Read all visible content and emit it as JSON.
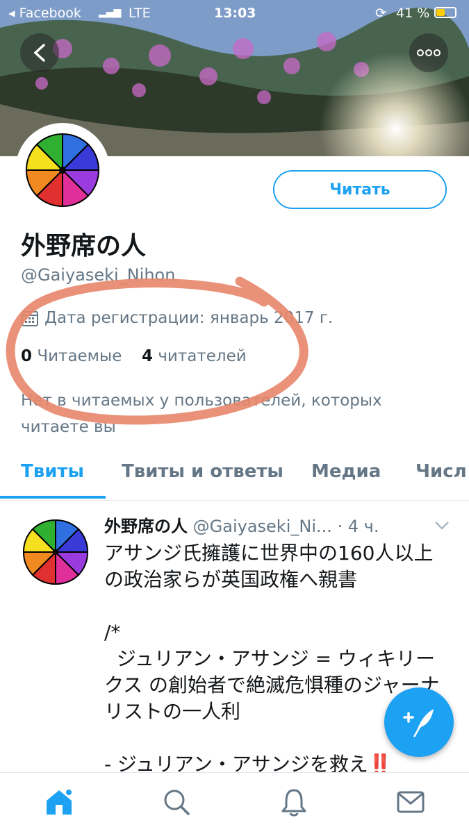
{
  "status_bar": {
    "back_app": "Facebook",
    "network": "LTE",
    "time": "13:03",
    "battery": "41 %"
  },
  "icons": {
    "back": "back-arrow-icon",
    "more": "more-dots-icon",
    "calendar": "calendar-icon",
    "compose": "compose-feather-icon",
    "home": "home-icon",
    "search": "search-icon",
    "notifications": "bell-icon",
    "messages": "mail-icon",
    "dropdown": "chevron-down-icon"
  },
  "colors": {
    "accent": "#1da1f2",
    "secondary_text": "#657786",
    "primary_text": "#14171a",
    "annotation": "#e8866a"
  },
  "profile": {
    "follow_label": "Читать",
    "name": "外野席の人",
    "handle": "@Gaiyaseki_Nihon",
    "joined": "Дата регистрации: январь 2017 г.",
    "following_count": "0",
    "following_label": "Читаемые",
    "followers_count": "4",
    "followers_label": "читателей",
    "followed_by_notice": "Нет в читаемых у пользователей, которых читаете вы"
  },
  "tabs": [
    {
      "label": "Твиты",
      "active": true
    },
    {
      "label": "Твиты и ответы",
      "active": false
    },
    {
      "label": "Медиа",
      "active": false
    },
    {
      "label": "Числ",
      "active": false
    }
  ],
  "tweet": {
    "name": "外野席の人",
    "handle": "@Gaiyaseki_Ni...",
    "time": "· 4 ч.",
    "text": "アサンジ氏擁護に世界中の160人以上の政治家らが英国政権へ親書\n\n/*\n  ジュリアン・アサンジ = ウィキリークス の創始者で絶滅危惧種のジャーナリストの一人利\n\n- ジュリアン・アサンジを救え‼️"
  }
}
